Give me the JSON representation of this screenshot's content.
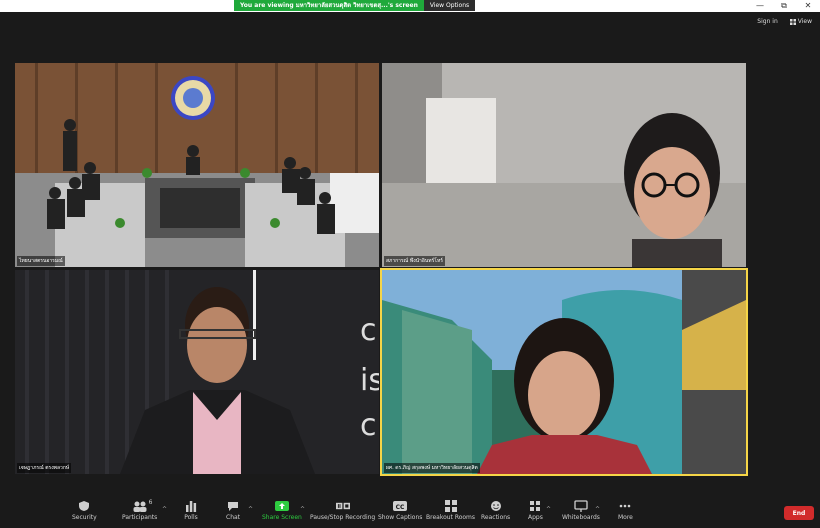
{
  "share_banner": {
    "message": "You are viewing มหาวิทยาลัยสวนดุสิต วิทยาเขตสุ...'s screen",
    "view_options": "View Options"
  },
  "window": {
    "minimize": "—",
    "maximize": "⧉",
    "close": "✕"
  },
  "top_right": {
    "sign_in": "Sign in",
    "view": "View"
  },
  "tiles": [
    {
      "name": "ไทยนาสตรนอารมณ์"
    },
    {
      "name": "สภาการณ์ พึงนำอินทร์โหร์"
    },
    {
      "name": "เจษฎาภรณ์ ตรงพลวกษ์"
    },
    {
      "name": "ผศ. ดร.ภิญ่ สกุลพงษ์ มหาวิทยาลัยสวนดุสิต"
    }
  ],
  "toolbar": {
    "security": "Security",
    "participants": "Participants",
    "participants_count": "6",
    "polls": "Polls",
    "chat": "Chat",
    "share_screen": "Share Screen",
    "record": "Pause/Stop Recording",
    "captions": "Show Captions",
    "breakout": "Breakout Rooms",
    "reactions": "Reactions",
    "apps": "Apps",
    "whiteboards": "Whiteboards",
    "more": "More",
    "end": "End"
  },
  "colors": {
    "accent_green": "#2ecc40",
    "end_red": "#d12b2b",
    "active_border": "#f5d547"
  }
}
